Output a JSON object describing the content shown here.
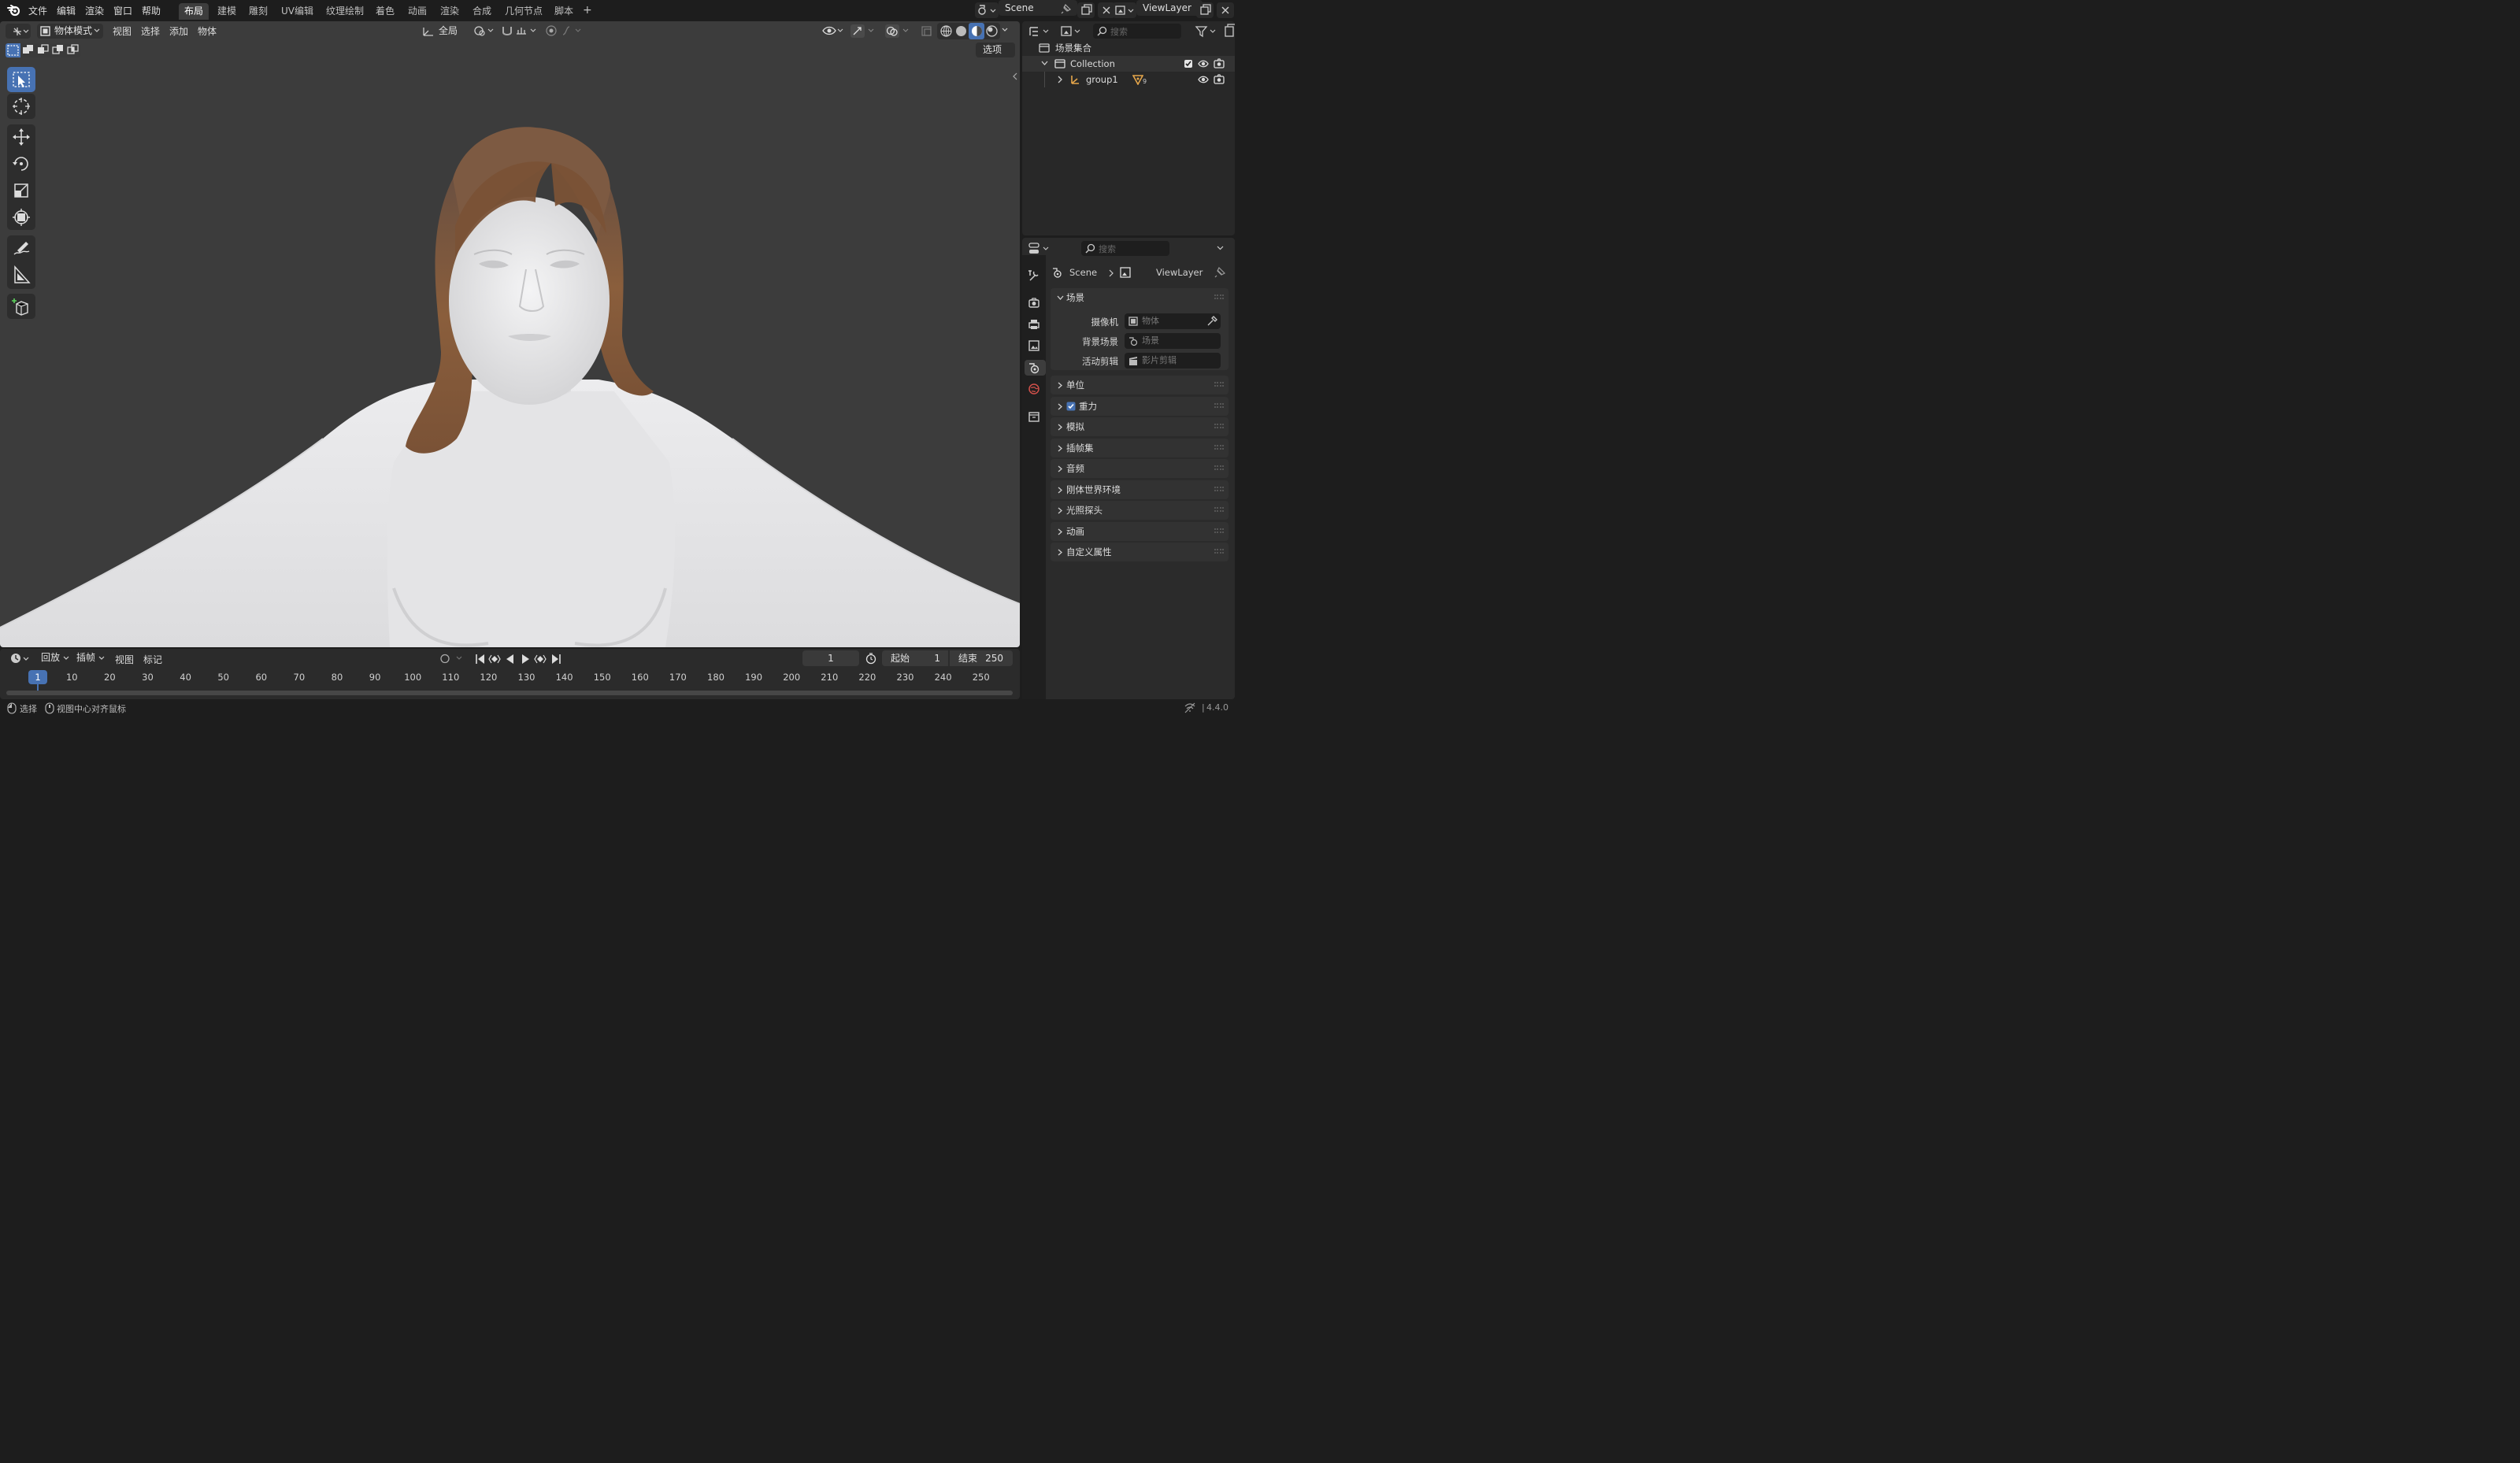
{
  "menu": [
    "文件",
    "编辑",
    "渲染",
    "窗口",
    "帮助"
  ],
  "workspaces": [
    "布局",
    "建模",
    "雕刻",
    "UV编辑",
    "纹理绘制",
    "着色",
    "动画",
    "渲染",
    "合成",
    "几何节点",
    "脚本"
  ],
  "active_workspace": "布局",
  "add_workspace": "+",
  "scene_name": "Scene",
  "view_layer_name": "ViewLayer",
  "viewport": {
    "mode": "物体模式",
    "menus": [
      "视图",
      "选择",
      "添加",
      "物体"
    ],
    "orientation": "全局",
    "options": "选项"
  },
  "timeline": {
    "playback": "回放",
    "keying": "插帧",
    "view": "视图",
    "marker": "标记",
    "current_frame": "1",
    "start_label": "起始",
    "start_value": "1",
    "end_label": "结束",
    "end_value": "250",
    "ticks": [
      "10",
      "20",
      "30",
      "40",
      "50",
      "60",
      "70",
      "80",
      "90",
      "100",
      "110",
      "120",
      "130",
      "140",
      "150",
      "160",
      "170",
      "180",
      "190",
      "200",
      "210",
      "220",
      "230",
      "240",
      "250"
    ],
    "playhead": "1"
  },
  "statusbar": {
    "select": "选择",
    "center": "视图中心对齐鼠标",
    "version": "4.4.0"
  },
  "outliner": {
    "search_placeholder": "搜索",
    "scene_collection": "场景集合",
    "collection": "Collection",
    "object": "group1",
    "modifier_count": "9"
  },
  "properties": {
    "search_placeholder": "搜索",
    "breadcrumb_scene": "Scene",
    "breadcrumb_layer": "ViewLayer",
    "scene_panel": "场景",
    "camera_label": "摄像机",
    "camera_placeholder": "物体",
    "bg_scene_label": "背景场景",
    "bg_scene_placeholder": "场景",
    "clip_label": "活动剪辑",
    "clip_placeholder": "影片剪辑",
    "panels": [
      "单位",
      "重力",
      "模拟",
      "插帧集",
      "音频",
      "刚体世界环境",
      "光照探头",
      "动画",
      "自定义属性"
    ]
  },
  "colors": {
    "accent": "#4772b3",
    "bg": "#1d1d1d",
    "viewport": "#3c3c3c",
    "panel": "#2b2b2b",
    "skin": "#e6e6e8",
    "hair": "#7a5236"
  }
}
